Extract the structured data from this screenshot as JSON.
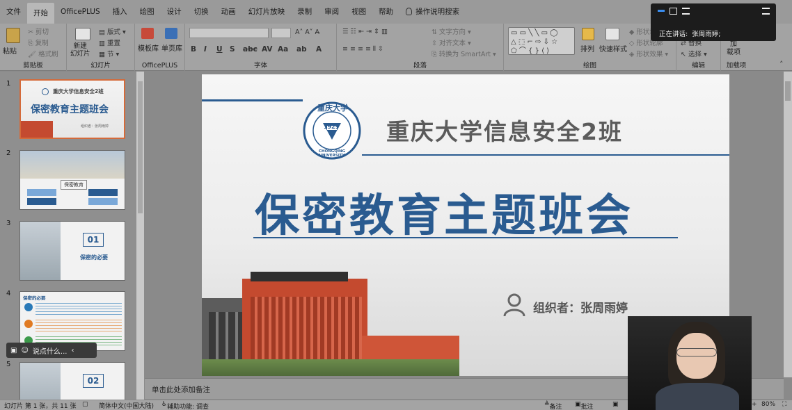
{
  "menu": {
    "tabs": [
      "文件",
      "开始",
      "OfficePLUS",
      "插入",
      "绘图",
      "设计",
      "切换",
      "动画",
      "幻灯片放映",
      "录制",
      "审阅",
      "视图",
      "帮助"
    ],
    "active_index": 1,
    "search_label": "操作说明搜索"
  },
  "ribbon": {
    "clipboard": {
      "label": "剪贴板",
      "paste": "粘贴",
      "cut": "剪切",
      "copy": "复制",
      "format_painter": "格式刷"
    },
    "slides": {
      "label": "幻灯片",
      "new_slide": "新建\n幻灯片",
      "layout": "版式",
      "reset": "重置",
      "section": "节"
    },
    "officeplus": {
      "label": "OfficePLUS",
      "template": "模板库",
      "single": "单页库"
    },
    "font": {
      "label": "字体"
    },
    "paragraph": {
      "label": "段落",
      "text_direction": "文字方向",
      "align_text": "对齐文本",
      "smartart": "转换为 SmartArt"
    },
    "drawing": {
      "label": "绘图",
      "arrange": "排列",
      "quick_styles": "快速样式",
      "shape_fill": "形状填充",
      "shape_outline": "形状轮廓",
      "shape_effects": "形状效果"
    },
    "editing": {
      "label": "编辑",
      "replace": "替换",
      "select": "选择"
    },
    "addins": {
      "label": "加载项",
      "button": "加\n载项"
    }
  },
  "thumbnails": [
    {
      "num": "1",
      "title": "保密教育主题班会",
      "subtitle": "重庆大学信息安全2班",
      "org": "组织者：张周雨婷"
    },
    {
      "num": "2",
      "title": "保密教育"
    },
    {
      "num": "3",
      "big": "01",
      "subtitle": "保密的必要"
    },
    {
      "num": "4",
      "title": "保密的必要"
    },
    {
      "num": "5",
      "big": "02"
    }
  ],
  "floatbar": {
    "text": "说点什么..."
  },
  "slide": {
    "class_title": "重庆大学信息安全2班",
    "main_title": "保密教育主题班会",
    "organizer": "组织者：张周雨婷",
    "logo_year": "1929",
    "logo_text": "CHONGQING UNIVERSITY",
    "logo_calligraphy": "重庆大学"
  },
  "notes": {
    "placeholder": "单击此处添加备注"
  },
  "status": {
    "slide_count": "幻灯片 第 1 张，共 11 张",
    "language": "简体中文(中国大陆)",
    "accessibility": "辅助功能: 调查",
    "notes_btn": "备注",
    "comments_btn": "批注",
    "zoom": "80%",
    "zoom_plus": "+"
  },
  "speaker": {
    "label": "正在讲话:",
    "name": "张周雨婷;"
  },
  "colors": {
    "accent_blue": "#2a5b90",
    "brick": "#c9482d",
    "thumb_selected": "#d46a3a"
  }
}
